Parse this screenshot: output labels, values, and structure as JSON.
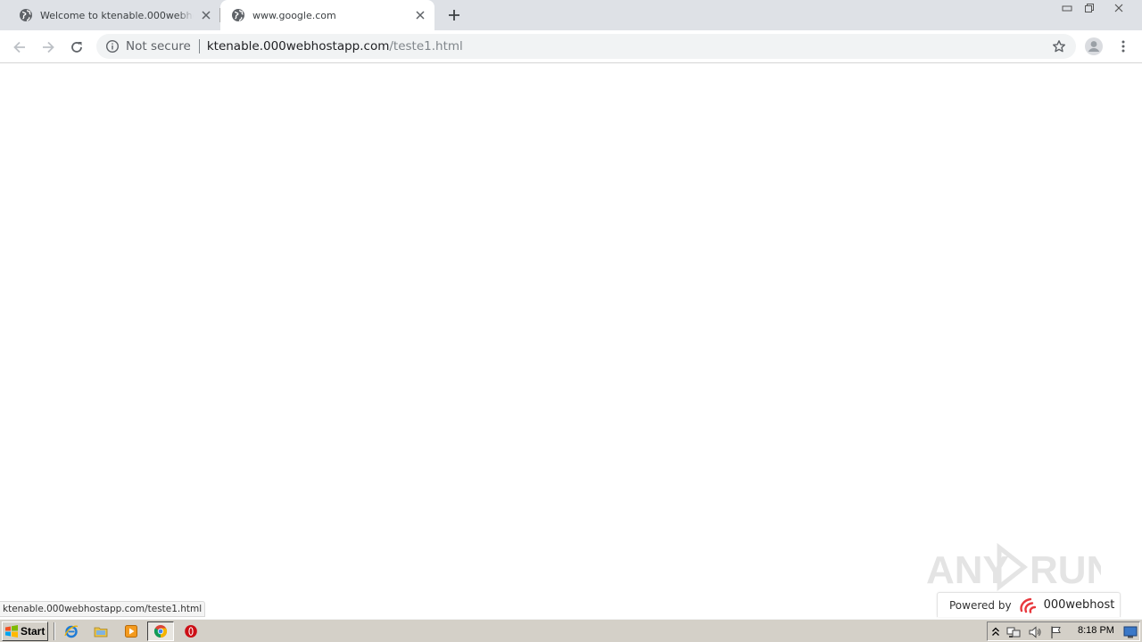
{
  "browser": {
    "tabs": [
      {
        "title": "Welcome to ktenable.000webhostapp.com",
        "active": false,
        "favicon": "globe-icon"
      },
      {
        "title": "www.google.com",
        "active": true,
        "favicon": "globe-icon"
      }
    ],
    "new_tab_icon": "plus-icon",
    "window_controls": [
      "minimize-icon",
      "restore-icon",
      "close-icon"
    ]
  },
  "toolbar": {
    "back_icon": "arrow-left-icon",
    "forward_icon": "arrow-right-icon",
    "reload_icon": "reload-icon",
    "security_label": "Not secure",
    "url_host": "ktenable.000webhostapp.com",
    "url_path": "/teste1.html",
    "bookmark_icon": "star-icon",
    "profile_icon": "avatar-icon",
    "menu_icon": "kebab-menu-icon"
  },
  "page": {
    "status_url": "ktenable.000webhostapp.com/teste1.html",
    "watermark": "ANY RUN",
    "powered_label": "Powered by",
    "powered_brand": "000webhost",
    "brand_color": "#e8383d"
  },
  "taskbar": {
    "start_label": "Start",
    "quick_launch": [
      "ie-icon",
      "folder-icon",
      "media-player-icon",
      "chrome-icon",
      "opera-icon"
    ],
    "tray_icons": [
      "arrow-up-icon",
      "network-icon",
      "volume-icon",
      "flag-icon"
    ],
    "clock": "8:18 PM",
    "show_desktop_icon": "desktop-icon"
  }
}
